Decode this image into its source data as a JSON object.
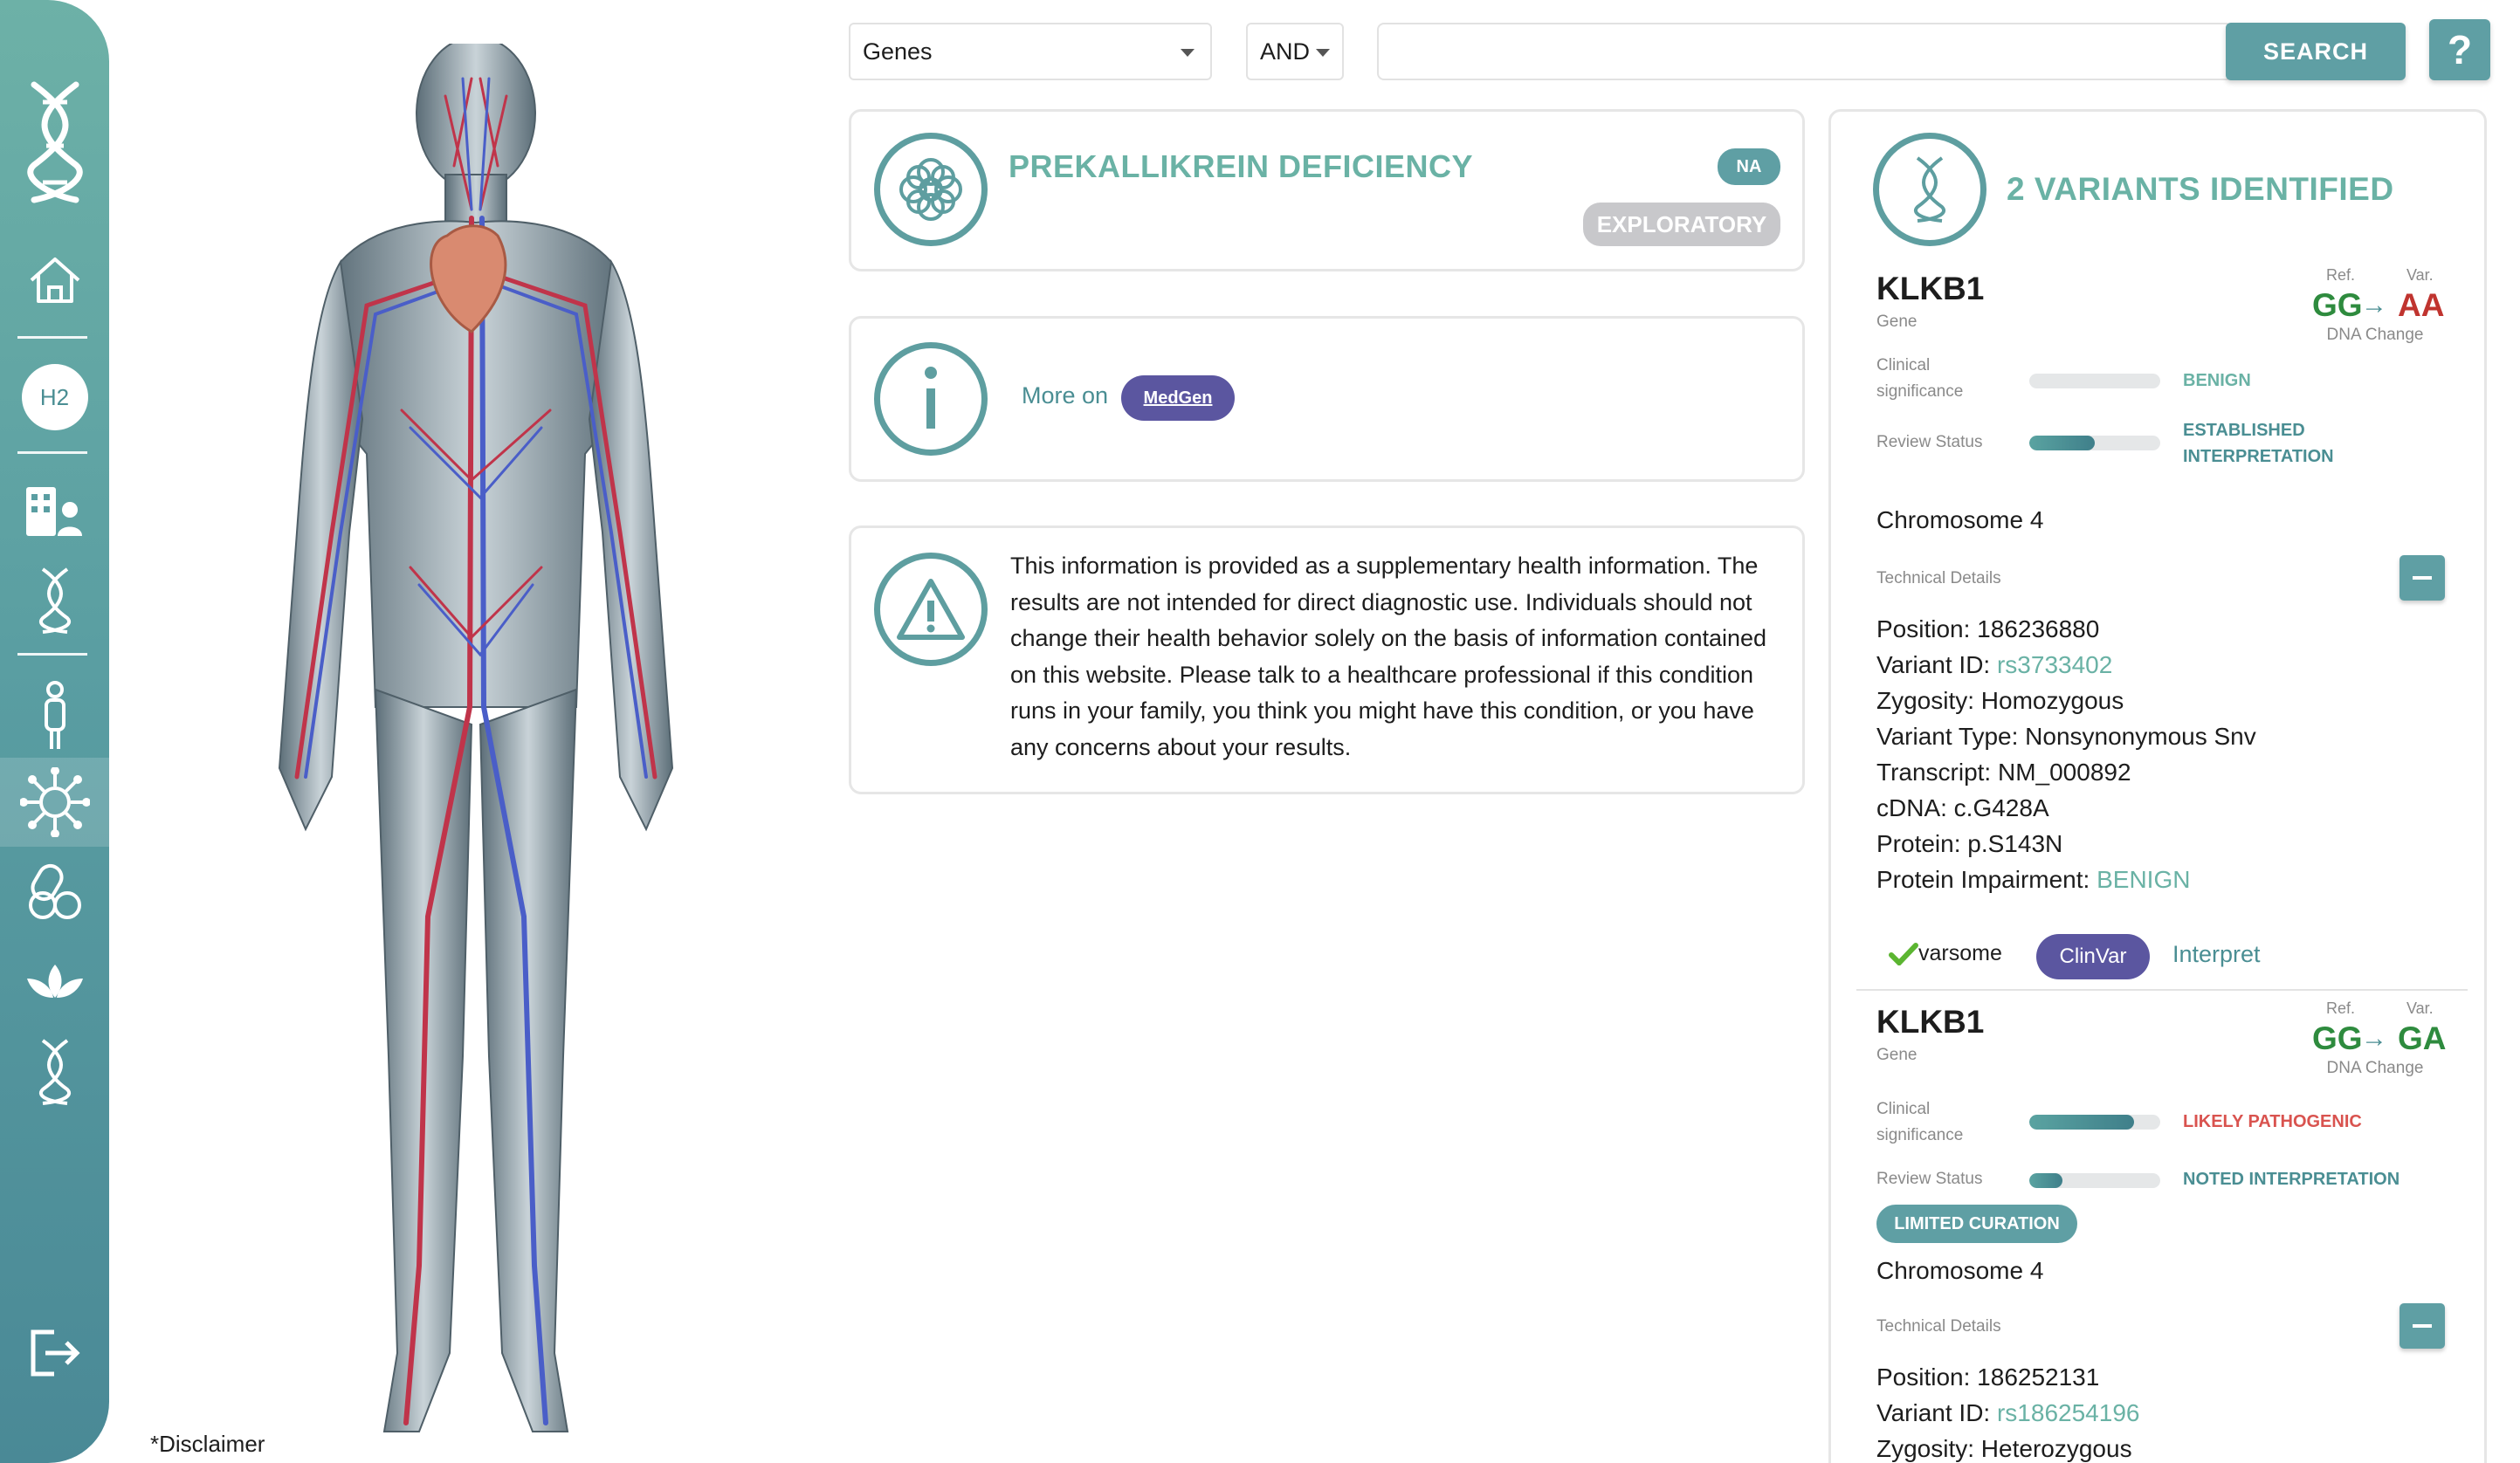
{
  "sidebar": {
    "items": [
      {
        "name": "dna-logo-icon"
      },
      {
        "name": "home-icon"
      },
      {
        "badge": "H2"
      },
      {
        "name": "hospital-user-icon"
      },
      {
        "name": "dna-icon"
      },
      {
        "name": "person-icon"
      },
      {
        "name": "virus-icon",
        "active": true
      },
      {
        "name": "pills-icon"
      },
      {
        "name": "lotus-icon"
      },
      {
        "name": "dna-small-icon"
      },
      {
        "name": "logout-icon"
      }
    ]
  },
  "body_image": {
    "disclaimer": "*Disclaimer"
  },
  "search": {
    "category": "Genes",
    "operator": "AND",
    "query": "",
    "button": "SEARCH",
    "help": "?"
  },
  "condition": {
    "title": "PREKALLIKREIN DEFICIENCY",
    "badge": "NA",
    "tag": "EXPLORATORY"
  },
  "more_info": {
    "label": "More on",
    "source": "MedGen"
  },
  "notice": {
    "text": "This information is provided as a supplementary health information. The results are not intended for direct diagnostic use. Individuals should not change their health behavior solely on the basis of information contained on this website. Please talk to a healthcare professional if this condition runs in your family, you think you might have this condition, or you have any concerns about your results."
  },
  "variants": {
    "title": "2 VARIANTS IDENTIFIED",
    "labels": {
      "gene": "Gene",
      "ref": "Ref.",
      "var": "Var.",
      "dna_change": "DNA Change",
      "clinical": "Clinical significance",
      "review": "Review Status",
      "tech": "Technical Details"
    },
    "colors": {
      "benign": "#6ab2a5",
      "pathogenic": "#d9534f",
      "review": "#4a8e93"
    },
    "items": [
      {
        "gene": "KLKB1",
        "ref": "GG",
        "alt": "AA",
        "clinical_significance": "BENIGN",
        "clinical_level": 0.0,
        "review_status": "ESTABLISHED INTERPRETATION",
        "review_level": 0.5,
        "chromosome": "Chromosome 4",
        "position": "Position: 186236880",
        "variant_id_label": "Variant ID:",
        "variant_id": "rs3733402",
        "zygosity": "Zygosity: Homozygous",
        "variant_type": "Variant Type: Nonsynonymous Snv",
        "transcript": "Transcript: NM_000892",
        "cdna": "cDNA: c.G428A",
        "protein": "Protein: p.S143N",
        "impairment_label": "Protein Impairment:",
        "impairment": "BENIGN",
        "links": {
          "varsome": "varsome",
          "clinvar": "ClinVar",
          "interpret": "Interpret"
        }
      },
      {
        "gene": "KLKB1",
        "ref": "GG",
        "alt": "GA",
        "clinical_significance": "LIKELY PATHOGENIC",
        "clinical_level": 0.8,
        "review_status": "NOTED INTERPRETATION",
        "review_level": 0.25,
        "curation": "LIMITED CURATION",
        "chromosome": "Chromosome 4",
        "position": "Position: 186252131",
        "variant_id_label": "Variant ID:",
        "variant_id": "rs186254196",
        "zygosity": "Zygosity: Heterozygous"
      }
    ]
  }
}
